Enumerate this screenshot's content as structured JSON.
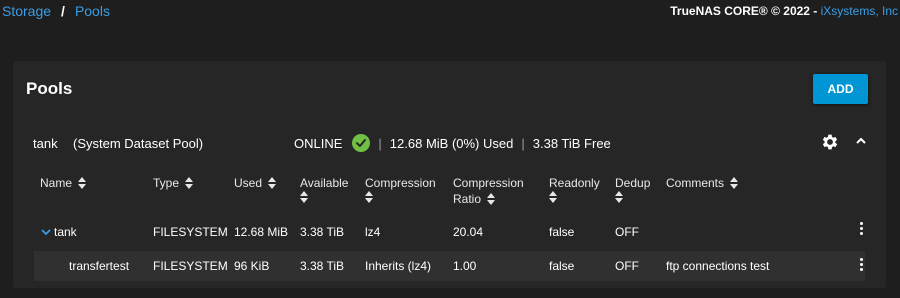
{
  "breadcrumb": {
    "root": "Storage",
    "separator": "/",
    "current": "Pools"
  },
  "copyright": {
    "text": "TrueNAS CORE® © 2022 - ",
    "vendor": "iXsystems, Inc"
  },
  "card": {
    "title": "Pools",
    "add_label": "ADD"
  },
  "pool": {
    "name": "tank",
    "description": "(System Dataset Pool)",
    "status": "ONLINE",
    "used": "12.68 MiB (0%) Used",
    "free": "3.38 TiB Free",
    "separator": "|",
    "status_icon": "check-circle-icon",
    "status_color": "#71bf44"
  },
  "table": {
    "columns": [
      {
        "label": "Name",
        "sub": ""
      },
      {
        "label": "Type",
        "sub": ""
      },
      {
        "label": "Used",
        "sub": ""
      },
      {
        "label": "Available",
        "sub": ""
      },
      {
        "label": "Compression",
        "sub": ""
      },
      {
        "label": "Compression",
        "sub": "Ratio"
      },
      {
        "label": "Readonly",
        "sub": ""
      },
      {
        "label": "Dedup",
        "sub": ""
      },
      {
        "label": "Comments",
        "sub": ""
      }
    ],
    "rows": [
      {
        "name": "tank",
        "type": "FILESYSTEM",
        "used": "12.68 MiB",
        "available": "3.38 TiB",
        "compression": "lz4",
        "ratio": "20.04",
        "readonly": "false",
        "dedup": "OFF",
        "comments": ""
      },
      {
        "name": "transfertest",
        "type": "FILESYSTEM",
        "used": "96 KiB",
        "available": "3.38 TiB",
        "compression": "Inherits (lz4)",
        "ratio": "1.00",
        "readonly": "false",
        "dedup": "OFF",
        "comments": "ftp connections test"
      }
    ]
  },
  "colors": {
    "accent": "#0095d5",
    "link": "#3a9ee6",
    "background": "#1e1e1e",
    "card": "#262626"
  }
}
